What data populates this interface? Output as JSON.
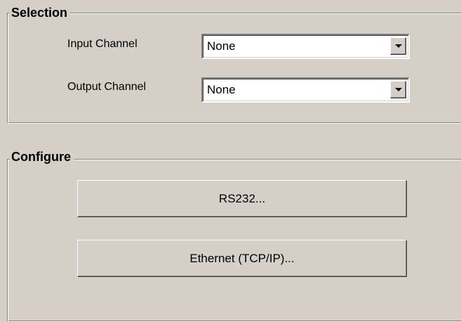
{
  "selection": {
    "title": "Selection",
    "input_label": "Input Channel",
    "input_value": "None",
    "output_label": "Output Channel",
    "output_value": "None"
  },
  "configure": {
    "title": "Configure",
    "rs232_label": "RS232...",
    "ethernet_label": "Ethernet (TCP/IP)..."
  }
}
